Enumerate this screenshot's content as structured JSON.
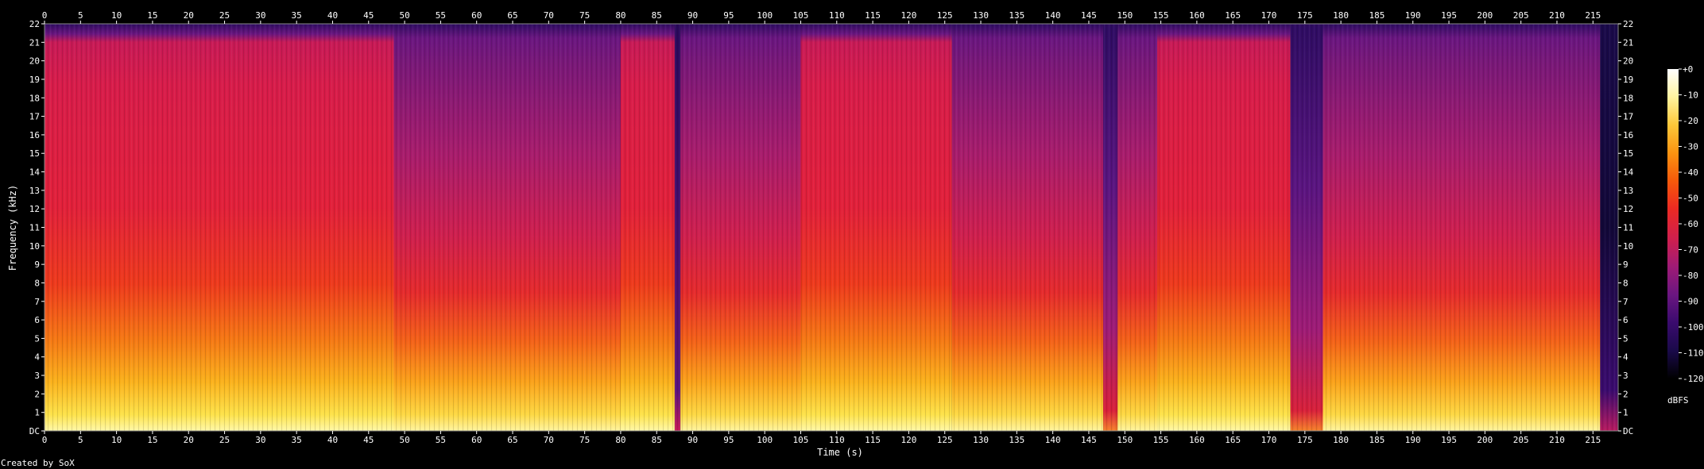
{
  "chart_data": {
    "type": "heatmap",
    "title": "",
    "xlabel": "Time (s)",
    "ylabel": "Frequency (kHz)",
    "x_ticks": [
      "0",
      "5",
      "10",
      "15",
      "20",
      "25",
      "30",
      "35",
      "40",
      "45",
      "50",
      "55",
      "60",
      "65",
      "70",
      "75",
      "80",
      "85",
      "90",
      "95",
      "100",
      "105",
      "110",
      "115",
      "120",
      "125",
      "130",
      "135",
      "140",
      "145",
      "150",
      "155",
      "160",
      "165",
      "170",
      "175",
      "180",
      "185",
      "190",
      "195",
      "200",
      "205",
      "210",
      "215"
    ],
    "y_ticks": [
      "DC",
      "1",
      "2",
      "3",
      "4",
      "5",
      "6",
      "7",
      "8",
      "9",
      "10",
      "11",
      "12",
      "13",
      "14",
      "15",
      "16",
      "17",
      "18",
      "19",
      "20",
      "21",
      "22"
    ],
    "xlim": [
      0,
      218.5
    ],
    "ylim": [
      0,
      22
    ],
    "colorbar": {
      "label": "dBFS",
      "ticks": [
        "+0",
        "-10",
        "-20",
        "-30",
        "-40",
        "-50",
        "-60",
        "-70",
        "-80",
        "-90",
        "-100",
        "-110",
        "-120"
      ],
      "range": [
        -120,
        0
      ],
      "colors": [
        "#000000",
        "#1a0a4a",
        "#3a0b6e",
        "#6a1680",
        "#9e1b76",
        "#cf1f4e",
        "#ec2a22",
        "#f65a0a",
        "#fb9411",
        "#fdc83a",
        "#fff4a0",
        "#ffffff"
      ]
    },
    "segments": [
      {
        "start": 0,
        "end": 48.5,
        "level": "loud"
      },
      {
        "start": 48.5,
        "end": 80,
        "level": "medium"
      },
      {
        "start": 80,
        "end": 87.5,
        "level": "loud"
      },
      {
        "start": 87.5,
        "end": 88.3,
        "level": "gap"
      },
      {
        "start": 88.3,
        "end": 105,
        "level": "medium"
      },
      {
        "start": 105,
        "end": 126,
        "level": "loud"
      },
      {
        "start": 126,
        "end": 147,
        "level": "medium"
      },
      {
        "start": 147,
        "end": 149,
        "level": "quiet"
      },
      {
        "start": 149,
        "end": 154.5,
        "level": "medium"
      },
      {
        "start": 154.5,
        "end": 173,
        "level": "loud"
      },
      {
        "start": 173,
        "end": 177.5,
        "level": "quiet"
      },
      {
        "start": 177.5,
        "end": 216,
        "level": "medium"
      },
      {
        "start": 216,
        "end": 218.5,
        "level": "fade"
      }
    ]
  },
  "footer": {
    "credit": "Created by SoX"
  }
}
